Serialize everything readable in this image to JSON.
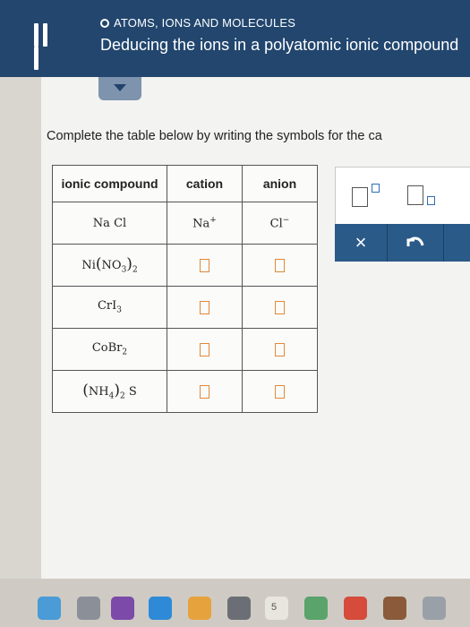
{
  "header": {
    "topic": "ATOMS, IONS AND MOLECULES",
    "title": "Deducing the ions in a polyatomic ionic compound"
  },
  "instruction": "Complete the table below by writing the symbols for the ca",
  "table": {
    "headers": [
      "ionic compound",
      "cation",
      "anion"
    ],
    "rows": [
      {
        "compound": "NaCl",
        "cation": "Na+",
        "anion": "Cl−"
      },
      {
        "compound": "Ni(NO3)2",
        "cation": "",
        "anion": ""
      },
      {
        "compound": "CrI3",
        "cation": "",
        "anion": ""
      },
      {
        "compound": "CoBr2",
        "cation": "",
        "anion": ""
      },
      {
        "compound": "(NH4)2S",
        "cation": "",
        "anion": ""
      }
    ],
    "text": {
      "na": "Na",
      "cl": "Cl",
      "ni": "Ni",
      "no": "NO",
      "cr": "Cr",
      "i": "I",
      "co": "Co",
      "br": "Br",
      "nh": "NH",
      "s": "S",
      "sub2": "2",
      "sub3": "3",
      "sub4": "4",
      "plus": "+",
      "minus": "−",
      "lparen": "(",
      "rparen": ")"
    }
  },
  "tools": {
    "clear_symbol": "×"
  },
  "taskbar": {
    "badge": "5"
  },
  "colors": {
    "header_bg": "#22466e",
    "tool_bar_bg": "#2a5a88",
    "input_box": "#e0893a",
    "exponent_box": "#2d6fb7"
  },
  "icons": [
    "menu-icon",
    "chevron-down-icon",
    "superscript-template-icon",
    "subscript-template-icon",
    "clear-icon",
    "undo-icon"
  ]
}
